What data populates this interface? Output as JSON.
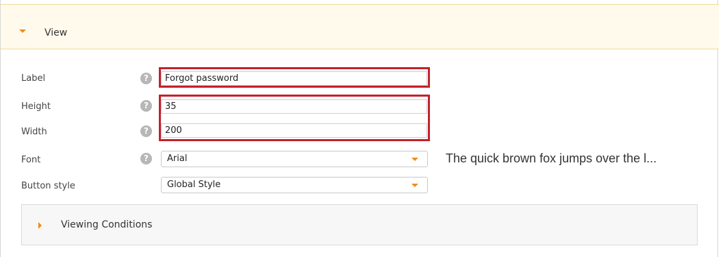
{
  "view_section": {
    "title": "View"
  },
  "fields": {
    "label": {
      "label": "Label",
      "value": "Forgot password"
    },
    "height": {
      "label": "Height",
      "value": "35"
    },
    "width": {
      "label": "Width",
      "value": "200"
    },
    "font": {
      "label": "Font",
      "value": "Arial",
      "preview": "The quick brown fox jumps over the l..."
    },
    "button_style": {
      "label": "Button style",
      "value": "Global Style"
    }
  },
  "help_glyph": "?",
  "viewing_conditions": {
    "title": "Viewing Conditions"
  },
  "colors": {
    "accent": "#f08a1c",
    "highlight": "#c4202c",
    "header_bg": "#fffaec"
  },
  "icons": {
    "expand": "caret-down-icon",
    "collapse": "caret-right-icon",
    "help": "help-icon"
  }
}
